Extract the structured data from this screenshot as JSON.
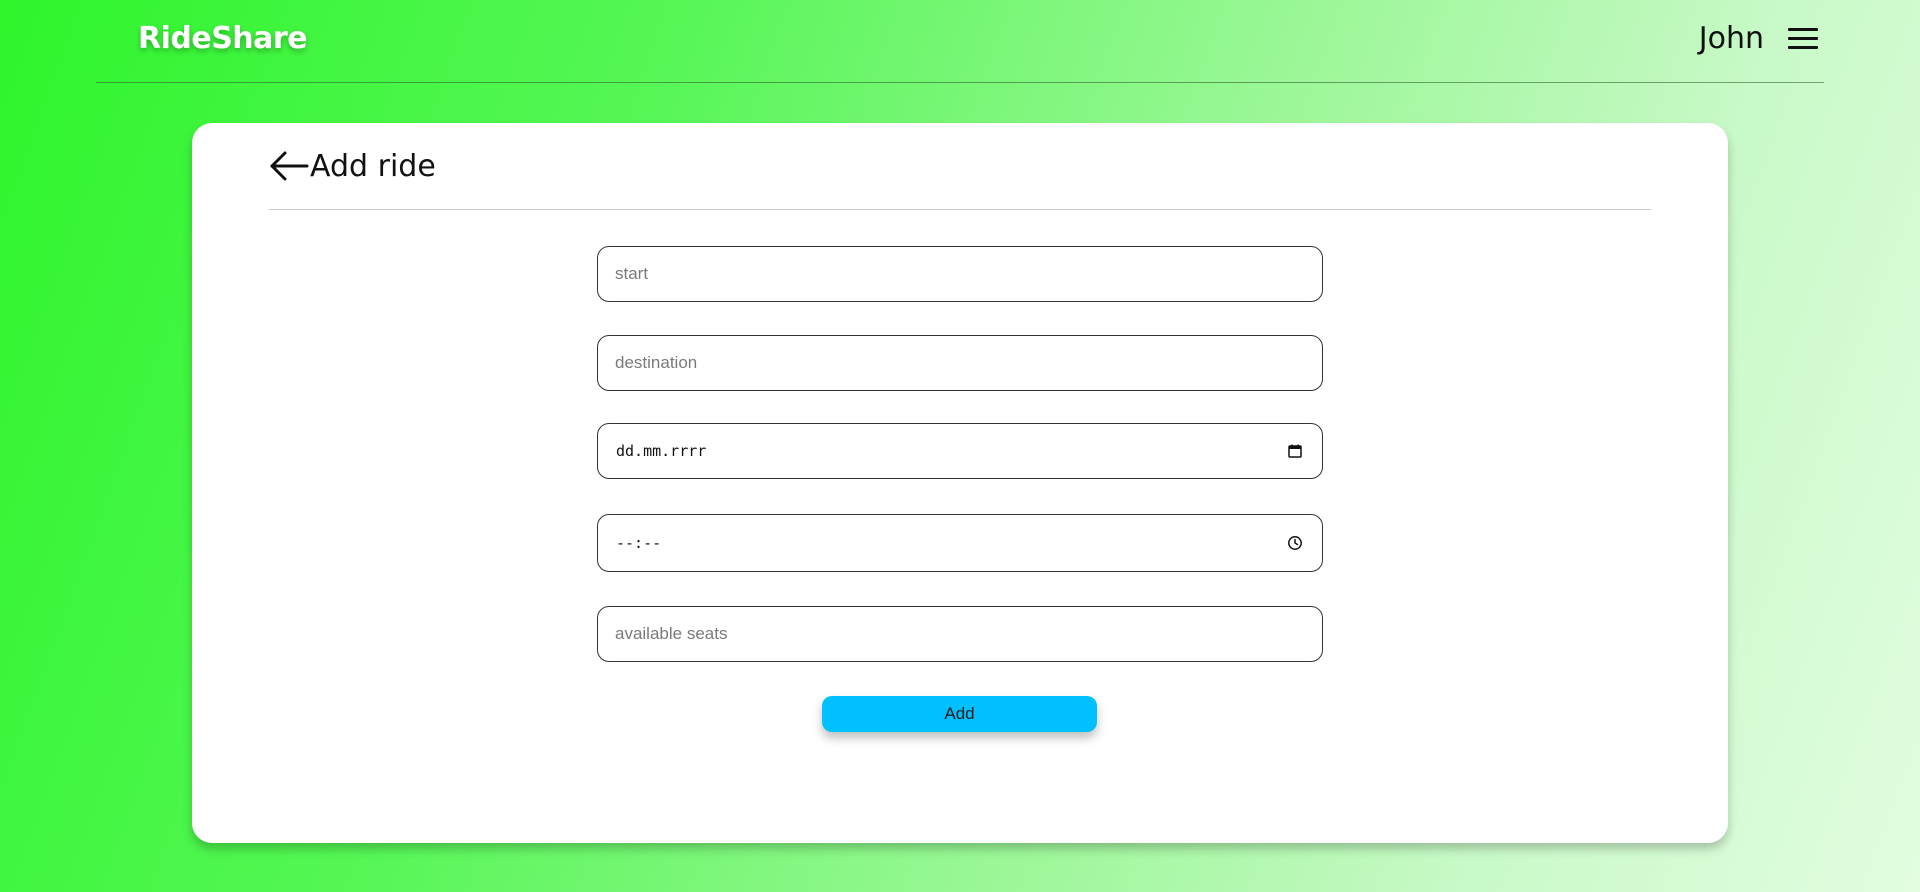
{
  "header": {
    "brand": "RideShare",
    "user_name": "John",
    "menu_icon": "hamburger-menu-icon"
  },
  "page": {
    "back_icon": "back-arrow-icon",
    "title": "Add ride"
  },
  "form": {
    "start": {
      "placeholder": "start",
      "value": ""
    },
    "destination": {
      "placeholder": "destination",
      "value": ""
    },
    "date": {
      "display": "dd.mm.rrrr",
      "icon": "calendar-icon"
    },
    "time": {
      "display": "--:--",
      "icon": "clock-icon"
    },
    "seats": {
      "placeholder": "available seats",
      "value": ""
    },
    "submit_label": "Add"
  },
  "colors": {
    "accent_button": "#00c0ff",
    "background_start": "#2ef52c",
    "background_end": "#e2fde0",
    "card": "#ffffff"
  }
}
